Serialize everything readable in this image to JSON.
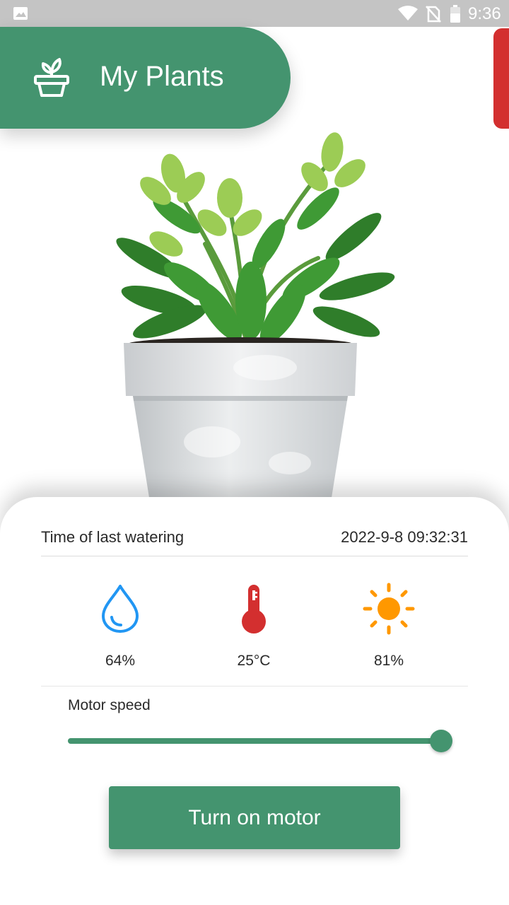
{
  "status_bar": {
    "time": "9:36",
    "icons": [
      "gallery-icon",
      "wifi-icon",
      "no-sim-icon",
      "battery-icon"
    ]
  },
  "header": {
    "title": "My Plants",
    "icon": "plant-pot-icon"
  },
  "colors": {
    "primary": "#44946f",
    "accent_tab": "#d32f2f",
    "humidity": "#2196f3",
    "temperature": "#d32f2f",
    "light": "#ff9800"
  },
  "watering": {
    "label": "Time of last watering",
    "value": "2022-9-8 09:32:31"
  },
  "sensors": {
    "humidity": {
      "icon": "water-drop-icon",
      "value": "64%"
    },
    "temperature": {
      "icon": "thermometer-icon",
      "value": "25°C"
    },
    "light": {
      "icon": "sun-icon",
      "value": "81%"
    }
  },
  "motor": {
    "label": "Motor speed",
    "speed_fraction": 1.0,
    "button_label": "Turn on motor"
  }
}
